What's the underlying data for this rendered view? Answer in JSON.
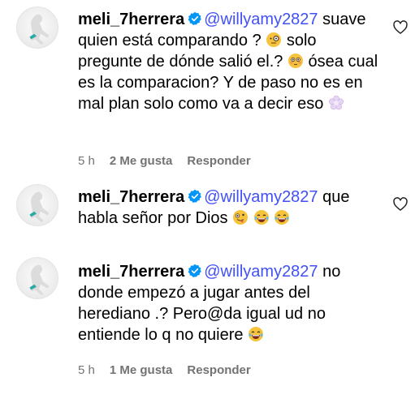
{
  "comments": [
    {
      "username": "meli_7herrera",
      "mention": "@willyamy2827",
      "text_parts": [
        " suave quien está comparando ? ",
        " solo pregunte de dónde salió el.? ",
        " ósea cual es la comparacion? Y de paso no es en mal plan solo como va a decir eso "
      ],
      "emojis": [
        "face-with-monocle-emoji",
        "flushed-face-emoji",
        "flower-emoji"
      ],
      "time": "5 h",
      "likes": "2 Me gusta",
      "reply": "Responder"
    },
    {
      "username": "meli_7herrera",
      "mention": "@willyamy2827",
      "text_parts": [
        " que habla señor por Dios "
      ],
      "emojis": [
        "zany-face-emoji",
        "tears-of-joy-emoji",
        "tears-of-joy-emoji"
      ]
    },
    {
      "username": "meli_7herrera",
      "mention": "@willyamy2827",
      "text_parts": [
        " no donde empezó a jugar antes del herediano .? Pero@da igual ud no entiende lo q no quiere "
      ],
      "emojis": [
        "tears-of-joy-emoji"
      ],
      "time": "5 h",
      "likes": "1 Me gusta",
      "reply": "Responder"
    }
  ],
  "colors": {
    "mention": "#4150f7",
    "meta": "#737373",
    "verified": "#0095f6"
  }
}
